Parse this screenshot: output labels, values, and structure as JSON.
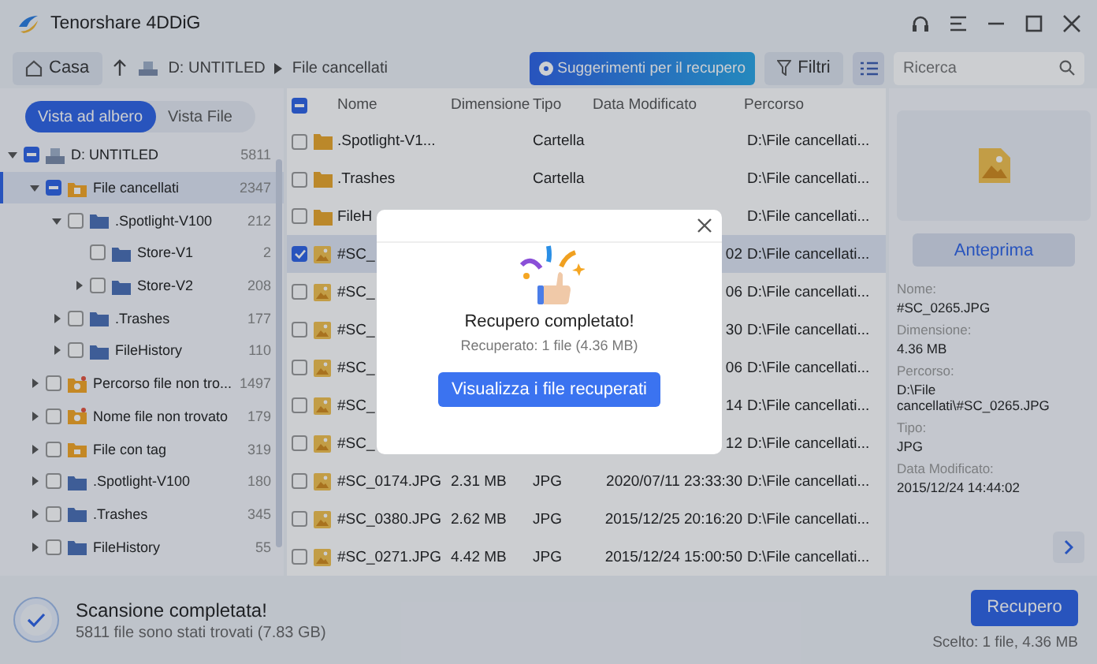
{
  "app": {
    "title": "Tenorshare 4DDiG"
  },
  "toolbar": {
    "home": "Casa",
    "breadcrumb": [
      "D: UNTITLED",
      "File cancellati"
    ],
    "suggestions": "Suggerimenti per il recupero",
    "filter": "Filtri",
    "search": {
      "placeholder": "Ricerca"
    }
  },
  "view_tabs": [
    {
      "label": "Vista ad albero",
      "selected": true
    },
    {
      "label": "Vista File",
      "selected": false
    }
  ],
  "tree": [
    {
      "kind": "drive",
      "name": "D: UNTITLED",
      "count": "5811",
      "partial": true,
      "expanded": true,
      "selected": false,
      "children": [
        {
          "kind": "deleted",
          "name": "File cancellati",
          "count": "2347",
          "partial": true,
          "expanded": true,
          "selected": true,
          "children": [
            {
              "kind": "folder",
              "name": ".Spotlight-V100",
              "count": "212",
              "checked": false,
              "partial": false,
              "expanded": true,
              "selected": false,
              "children": [
                {
                  "kind": "folder",
                  "name": "Store-V1",
                  "count": "2",
                  "checked": false,
                  "partial": false,
                  "selected": false
                },
                {
                  "kind": "folder",
                  "name": "Store-V2",
                  "count": "208",
                  "checked": false,
                  "partial": false,
                  "expanded": false,
                  "selected": false
                }
              ]
            },
            {
              "kind": "folder",
              "name": ".Trashes",
              "count": "177",
              "checked": false,
              "partial": false,
              "expanded": false,
              "selected": false
            },
            {
              "kind": "folder",
              "name": "FileHistory",
              "count": "110",
              "checked": false,
              "partial": false,
              "expanded": false,
              "selected": false
            }
          ]
        },
        {
          "kind": "lost",
          "name": "Percorso file non tro...",
          "count": "1497",
          "checked": false,
          "partial": false,
          "expanded": false,
          "selected": false
        },
        {
          "kind": "lost",
          "name": "Nome file non trovato",
          "count": "179",
          "checked": false,
          "partial": false,
          "expanded": false,
          "selected": false
        },
        {
          "kind": "tagged",
          "name": "File con tag",
          "count": "319",
          "checked": false,
          "partial": false,
          "expanded": false,
          "selected": false
        },
        {
          "kind": "folder",
          "name": ".Spotlight-V100",
          "count": "180",
          "checked": false,
          "partial": false,
          "expanded": false,
          "selected": false
        },
        {
          "kind": "folder",
          "name": ".Trashes",
          "count": "345",
          "checked": false,
          "partial": false,
          "expanded": false,
          "selected": false
        },
        {
          "kind": "folder",
          "name": "FileHistory",
          "count": "55",
          "checked": false,
          "partial": false,
          "expanded": false,
          "selected": false
        }
      ]
    }
  ],
  "table": {
    "columns": [
      "Nome",
      "Dimensione",
      "Tipo",
      "Data Modificato",
      "Percorso"
    ],
    "header_partial": true,
    "rows": [
      {
        "kind": "folder",
        "checked": false,
        "selected": false,
        "name": ".Spotlight-V1...",
        "type": "Cartella",
        "path": "D:\\File cancellati..."
      },
      {
        "kind": "folder",
        "checked": false,
        "selected": false,
        "name": ".Trashes",
        "type": "Cartella",
        "path": "D:\\File cancellati..."
      },
      {
        "kind": "folder",
        "checked": false,
        "selected": false,
        "name": "FileH",
        "path": "D:\\File cancellati..."
      },
      {
        "kind": "image",
        "checked": true,
        "selected": true,
        "name": "#SC_",
        "date": "02",
        "path": "D:\\File cancellati..."
      },
      {
        "kind": "image",
        "checked": false,
        "selected": false,
        "name": "#SC_",
        "date": "06",
        "path": "D:\\File cancellati..."
      },
      {
        "kind": "image",
        "checked": false,
        "selected": false,
        "name": "#SC_",
        "date": "30",
        "path": "D:\\File cancellati..."
      },
      {
        "kind": "image",
        "checked": false,
        "selected": false,
        "name": "#SC_",
        "date": "06",
        "path": "D:\\File cancellati..."
      },
      {
        "kind": "image",
        "checked": false,
        "selected": false,
        "name": "#SC_",
        "date": "14",
        "path": "D:\\File cancellati..."
      },
      {
        "kind": "image",
        "checked": false,
        "selected": false,
        "name": "#SC_",
        "date": "12",
        "path": "D:\\File cancellati..."
      },
      {
        "kind": "image",
        "checked": false,
        "selected": false,
        "name": "#SC_0174.JPG",
        "size": "2.31 MB",
        "type": "JPG",
        "date": "2020/07/11 23:33:30",
        "path": "D:\\File cancellati..."
      },
      {
        "kind": "image",
        "checked": false,
        "selected": false,
        "name": "#SC_0380.JPG",
        "size": "2.62 MB",
        "type": "JPG",
        "date": "2015/12/25 20:16:20",
        "path": "D:\\File cancellati..."
      },
      {
        "kind": "image",
        "checked": false,
        "selected": false,
        "name": "#SC_0271.JPG",
        "size": "4.42 MB",
        "type": "JPG",
        "date": "2015/12/24 15:00:50",
        "path": "D:\\File cancellati..."
      }
    ]
  },
  "preview": {
    "button": "Anteprima",
    "details": [
      {
        "label": "Nome:",
        "value": "#SC_0265.JPG"
      },
      {
        "label": "Dimensione:",
        "value": "4.36 MB"
      },
      {
        "label": "Percorso:",
        "value": "D:\\File cancellati\\#SC_0265.JPG"
      },
      {
        "label": "Tipo:",
        "value": "JPG"
      },
      {
        "label": "Data Modificato:",
        "value": "2015/12/24 14:44:02"
      }
    ]
  },
  "status": {
    "title": "Scansione completata!",
    "subtitle": "5811 file sono stati trovati (7.83 GB)",
    "recover": "Recupero",
    "selection": "Scelto: 1 file, 4.36 MB"
  },
  "dialog": {
    "title": "Recupero completato!",
    "subtitle": "Recuperato: 1 file (4.36 MB)",
    "button": "Visualizza i file recuperati"
  }
}
